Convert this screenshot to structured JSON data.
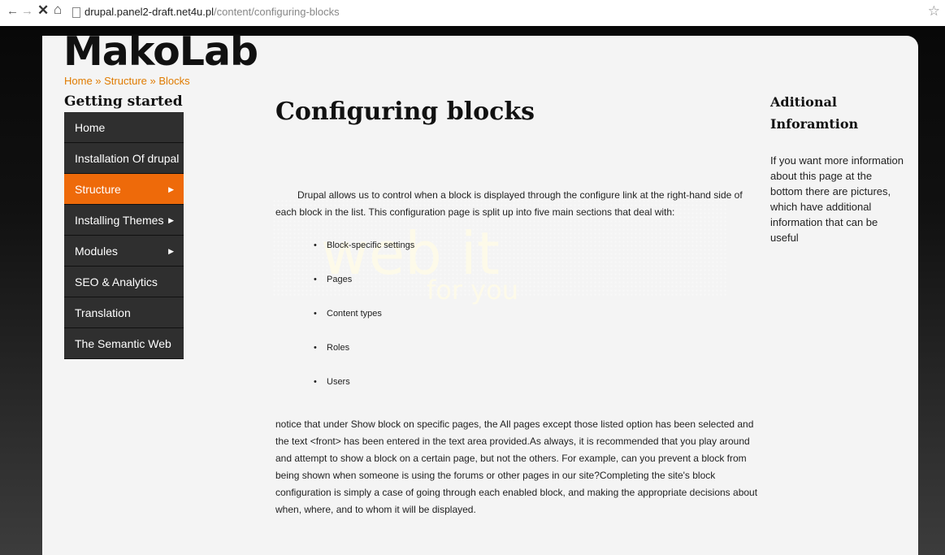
{
  "browser": {
    "url_domain": "drupal.panel2-draft.net4u.pl",
    "url_path": "/content/configuring-blocks"
  },
  "site": {
    "logo": "MakoLab",
    "breadcrumb": "Home » Structure » Blocks"
  },
  "sidebar": {
    "title": "Getting started",
    "items": [
      {
        "label": "Home",
        "arrow": false,
        "active": false
      },
      {
        "label": "Installation Of drupal",
        "arrow": false,
        "active": false
      },
      {
        "label": "Structure",
        "arrow": true,
        "active": true
      },
      {
        "label": "Installing Themes",
        "arrow": true,
        "active": false
      },
      {
        "label": "Modules",
        "arrow": true,
        "active": false
      },
      {
        "label": "SEO & Analytics",
        "arrow": false,
        "active": false
      },
      {
        "label": "Translation",
        "arrow": false,
        "active": false
      },
      {
        "label": "The Semantic Web",
        "arrow": false,
        "active": false
      }
    ]
  },
  "watermark": {
    "main": "web it",
    "sub": "for you"
  },
  "main": {
    "title": "Configuring blocks",
    "intro": "Drupal allows us to control when a block is displayed through the configure link at the right-hand side of each block in the list. This configuration page is split up into five main sections that deal with:",
    "bullets": [
      "Block-specific settings",
      "Pages",
      "Content types",
      "Roles",
      "Users"
    ],
    "outro": "notice that under Show block on specific pages, the All pages except those listed option has been selected and the text <front> has been entered in the text area provided.As always, it is recommended that you play around and attempt to show a block on a certain page, but not the others. For example, can you prevent a block from being shown when someone is using the forums or other pages in our site?Completing the site's block configuration is simply a case of going through each enabled block, and making the appropriate decisions about when, where, and to whom it will be displayed."
  },
  "aside": {
    "title": "Aditional Inforamtion",
    "text_line1": "If you want more information about this page at the bottom there are pictures,",
    "text_line2": "which have additional information that can be useful"
  },
  "colors": {
    "accent": "#ee6a0a",
    "menu_bg": "#2f2f2f",
    "breadcrumb": "#e07b00"
  }
}
